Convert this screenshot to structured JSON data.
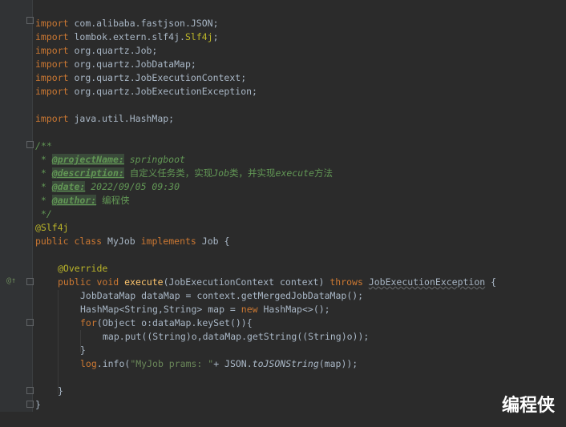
{
  "editor": {
    "lines": {
      "l1": [
        "import",
        "com.alibaba.fastjson.JSON;"
      ],
      "l2": [
        "import",
        "lombok.extern.slf4j.",
        "Slf4j",
        ";"
      ],
      "l3": [
        "import",
        "org.quartz.Job;"
      ],
      "l4": [
        "import",
        "org.quartz.JobDataMap;"
      ],
      "l5": [
        "import",
        "org.quartz.JobExecutionContext;"
      ],
      "l6": [
        "import",
        "org.quartz.JobExecutionException;"
      ],
      "l7": [
        "import",
        "java.util.HashMap;"
      ],
      "l8": "/**",
      "l9": [
        " * ",
        "@projectName:",
        " springboot"
      ],
      "l10": [
        " * ",
        "@description:",
        " ",
        "自定义任务类，实现",
        "Job",
        "类，并实现",
        "execute",
        "方法"
      ],
      "l11": [
        " * ",
        "@date:",
        " 2022/09/05 09:30"
      ],
      "l12": [
        " * ",
        "@author:",
        " ",
        "编程侠"
      ],
      "l13": " */",
      "l14": "@Slf4j",
      "l15": [
        "public",
        "class",
        "MyJob",
        "implements",
        "Job {"
      ],
      "l16": "@Override",
      "l17": [
        "public",
        "void",
        "execute",
        "(JobExecutionContext context)",
        "throws",
        "JobExecutionException",
        " {"
      ],
      "l18": "JobDataMap dataMap = context.getMergedJobDataMap();",
      "l19": [
        "HashMap<String,String> map = ",
        "new",
        " HashMap<>();"
      ],
      "l20": [
        "for",
        "(Object o:dataMap.keySet()){"
      ],
      "l21": "map.put((String)o,dataMap.getString((String)o));",
      "l22": "}",
      "l23": [
        "log",
        ".info(",
        "\"MyJob prams: \"",
        "+ JSON.",
        "toJSONString",
        "(map));"
      ],
      "l24": "}",
      "l25": "}"
    }
  },
  "gutter": {
    "override_marker": "@↑"
  },
  "watermark": "编程侠"
}
